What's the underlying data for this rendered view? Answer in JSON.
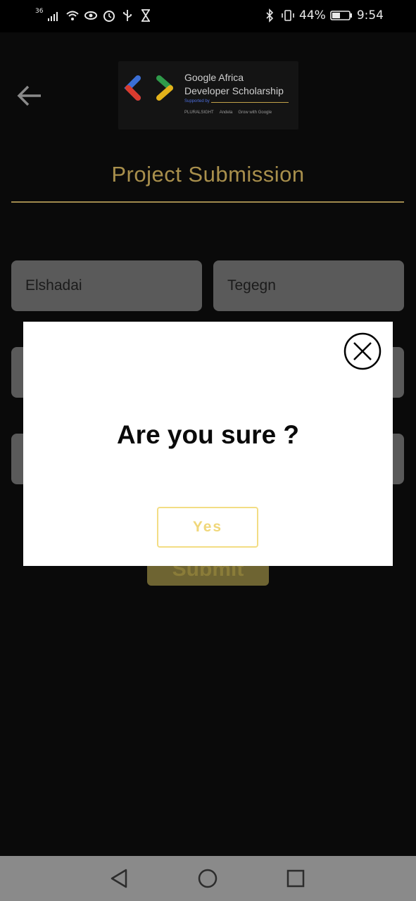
{
  "status_bar": {
    "network": "36",
    "battery_percent": "44%",
    "time": "9:54"
  },
  "header": {
    "banner": {
      "title_line1": "Google Africa",
      "title_line2": "Developer Scholarship",
      "supported_by": "Supported by",
      "partners": [
        "PLURALSIGHT",
        "Andela",
        "Grow with Google"
      ]
    },
    "page_title": "Project Submission"
  },
  "form": {
    "first_name": "Elshadai",
    "last_name": "Tegegn",
    "submit_label": "Submit"
  },
  "dialog": {
    "message": "Are you sure ?",
    "confirm_label": "Yes"
  },
  "colors": {
    "accent_gold": "#a88f4c",
    "dialog_button_border": "#f3dd84"
  }
}
